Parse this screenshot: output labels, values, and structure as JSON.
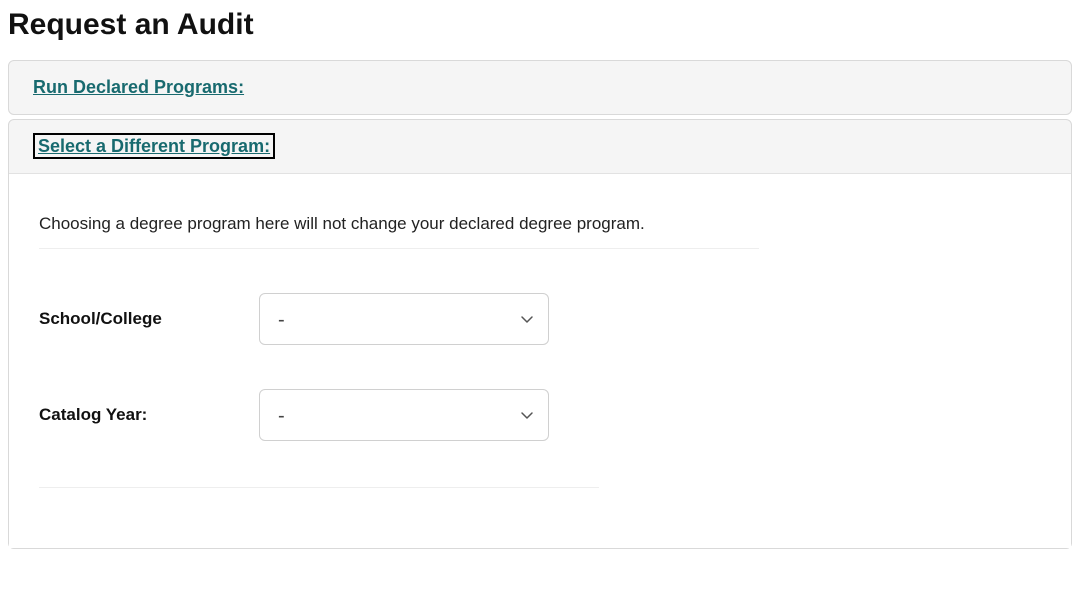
{
  "title": "Request an Audit",
  "panels": {
    "declared": {
      "header": "Run Declared Programs:"
    },
    "select_program": {
      "header": "Select a Different Program:",
      "info": "Choosing a degree program here will not change your declared degree program.",
      "fields": {
        "school_college": {
          "label": "School/College",
          "value": "-"
        },
        "catalog_year": {
          "label": "Catalog Year:",
          "value": "-"
        }
      }
    }
  }
}
